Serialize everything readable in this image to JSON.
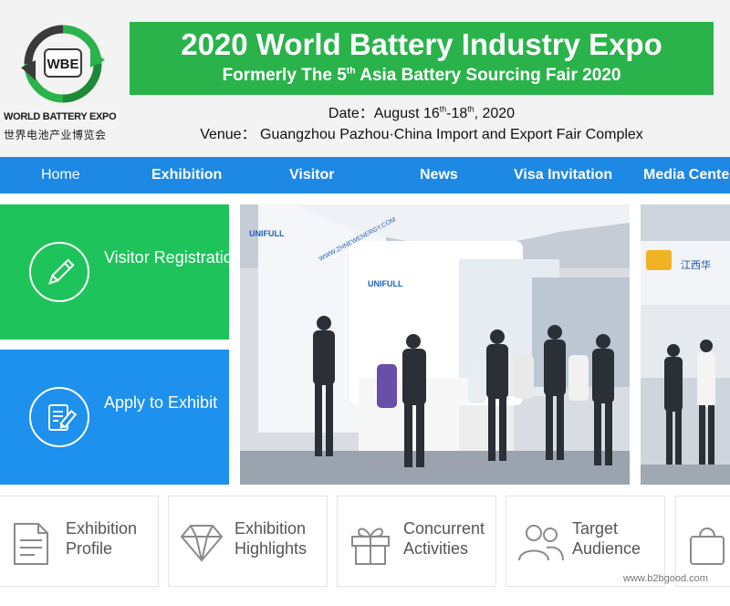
{
  "header": {
    "logo_badge": "WBE",
    "logo_en": "WORLD BATTERY EXPO",
    "logo_cn": "世界电池产业博览会",
    "title": "2020 World Battery Industry Expo",
    "subtitle_pre": "Formerly The 5",
    "subtitle_sup": "th",
    "subtitle_post": " Asia Battery Sourcing Fair 2020",
    "date_pre": "Date：August 16",
    "date_sup1": "th",
    "date_mid": "-18",
    "date_sup2": "th",
    "date_post": ", 2020",
    "venue": "Venue：  Guangzhou Pazhou·China Import and Export Fair Complex"
  },
  "nav": {
    "items": [
      "Home",
      "Exhibition",
      "Visitor",
      "News",
      "Visa Invitation",
      "Media Center"
    ]
  },
  "cards": {
    "visitor": "Visitor Registration",
    "exhibit": "Apply to Exhibit"
  },
  "photos": {
    "main_booth_text": "UNIFULL",
    "main_wall_text": "WWW.ZHNEWENERGY.COM",
    "side_sign_text": "江西华"
  },
  "boxes": [
    {
      "line1": "Exhibition",
      "line2": "Profile",
      "icon": "document-icon"
    },
    {
      "line1": "Exhibition",
      "line2": "Highlights",
      "icon": "diamond-icon"
    },
    {
      "line1": "Concurrent",
      "line2": "Activities",
      "icon": "gift-icon"
    },
    {
      "line1": "Target",
      "line2": "Audience",
      "icon": "users-icon"
    },
    {
      "line1": "",
      "line2": "",
      "icon": "shopping-bag-icon"
    }
  ],
  "watermark": "www.b2bgood.com",
  "colors": {
    "nav_blue": "#1e88e5",
    "banner_green": "#2ab34a",
    "card_green": "#1ec45b",
    "card_blue": "#1e90ee"
  }
}
